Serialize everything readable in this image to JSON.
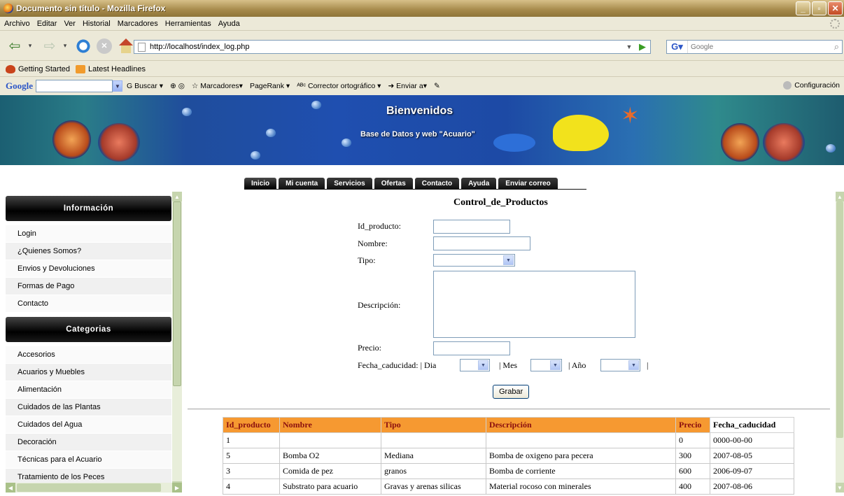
{
  "window": {
    "title": "Documento sin título - Mozilla Firefox"
  },
  "menu": [
    "Archivo",
    "Editar",
    "Ver",
    "Historial",
    "Marcadores",
    "Herramientas",
    "Ayuda"
  ],
  "address": {
    "url": "http://localhost/index_log.php"
  },
  "search": {
    "placeholder": "Google"
  },
  "bookmarks": [
    "Getting Started",
    "Latest Headlines"
  ],
  "google_toolbar": {
    "logo": "Google",
    "buscar": "Buscar",
    "marcadores": "Marcadores",
    "pagerank": "PageRank",
    "corrector": "Corrector ortográfico",
    "enviar": "Enviar a",
    "config": "Configuración"
  },
  "banner": {
    "title": "Bienvenidos",
    "subtitle": "Base de Datos y web \"Acuario\""
  },
  "tabs": [
    "Inicio",
    "Mi cuenta",
    "Servicios",
    "Ofertas",
    "Contacto",
    "Ayuda",
    "Enviar correo"
  ],
  "sidebar": {
    "info_heading": "Información",
    "info_items": [
      "Login",
      "¿Quienes Somos?",
      "Envios y Devoluciones",
      "Formas de Pago",
      "Contacto"
    ],
    "cat_heading": "Categorias",
    "cat_items": [
      "Accesorios",
      "Acuarios y Muebles",
      "Alimentación",
      "Cuidados de las Plantas",
      "Cuidados del Agua",
      "Decoración",
      "Técnicas para el Acuario",
      "Tratamiento de los Peces"
    ]
  },
  "form": {
    "title": "Control_de_Productos",
    "id_label": "Id_producto:",
    "nombre_label": "Nombre:",
    "tipo_label": "Tipo:",
    "desc_label": "Descripción:",
    "precio_label": "Precio:",
    "fecha_label": "Fecha_caducidad: | Dia",
    "mes_label": "| Mes",
    "anio_label": "| Año",
    "end_bar": "|",
    "submit": "Grabar"
  },
  "table": {
    "headers": [
      "Id_producto",
      "Nombre",
      "Tipo",
      "Descripción",
      "Precio",
      "Fecha_caducidad"
    ],
    "rows": [
      [
        "1",
        "",
        "",
        "",
        "0",
        "0000-00-00"
      ],
      [
        "5",
        "Bomba O2",
        "Mediana",
        "Bomba de oxigeno para pecera",
        "300",
        "2007-08-05"
      ],
      [
        "3",
        "Comida de pez",
        "granos",
        "Bomba de corriente",
        "600",
        "2006-09-07"
      ],
      [
        "4",
        "Substrato para acuario",
        "Gravas y arenas silicas",
        "Material rocoso con minerales",
        "400",
        "2007-08-06"
      ]
    ]
  }
}
